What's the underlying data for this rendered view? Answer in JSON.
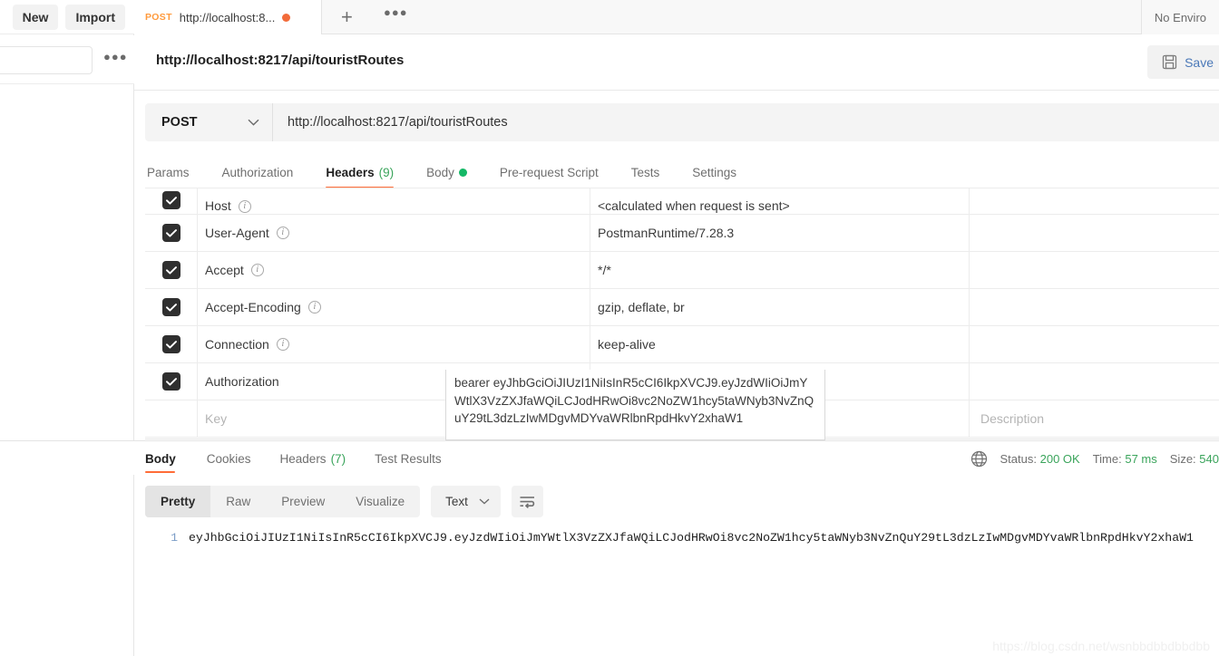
{
  "sidebar": {
    "new_label": "New",
    "import_label": "Import",
    "more_options": "···",
    "search_placeholder": ""
  },
  "tabbar": {
    "tabs": [
      {
        "method": "POST",
        "title": "http://localhost:8...",
        "unsaved": true
      }
    ],
    "new_tab_icon": "+",
    "tab_options_icon": "···",
    "environment_label": "No Enviro"
  },
  "request": {
    "name": "http://localhost:8217/api/touristRoutes",
    "save_label": "Save",
    "method": "POST",
    "url": "http://localhost:8217/api/touristRoutes",
    "tabs": [
      {
        "label": "Params",
        "active": false,
        "count": "",
        "dot": false
      },
      {
        "label": "Authorization",
        "active": false,
        "count": "",
        "dot": false
      },
      {
        "label": "Headers",
        "active": true,
        "count": "(9)",
        "dot": false
      },
      {
        "label": "Body",
        "active": false,
        "count": "",
        "dot": true
      },
      {
        "label": "Pre-request Script",
        "active": false,
        "count": "",
        "dot": false
      },
      {
        "label": "Tests",
        "active": false,
        "count": "",
        "dot": false
      },
      {
        "label": "Settings",
        "active": false,
        "count": "",
        "dot": false
      }
    ]
  },
  "headers_table": {
    "key_placeholder": "Key",
    "description_placeholder": "Description",
    "rows": [
      {
        "checked": true,
        "key": "Host",
        "info": true,
        "value": "<calculated when request is sent>",
        "description": ""
      },
      {
        "checked": true,
        "key": "User-Agent",
        "info": true,
        "value": "PostmanRuntime/7.28.3",
        "description": ""
      },
      {
        "checked": true,
        "key": "Accept",
        "info": true,
        "value": "*/*",
        "description": ""
      },
      {
        "checked": true,
        "key": "Accept-Encoding",
        "info": true,
        "value": "gzip, deflate, br",
        "description": ""
      },
      {
        "checked": true,
        "key": "Connection",
        "info": true,
        "value": "keep-alive",
        "description": ""
      },
      {
        "checked": true,
        "key": "Authorization",
        "info": false,
        "value": "",
        "description": ""
      }
    ],
    "authorization_value": "bearer eyJhbGciOiJIUzI1NiIsInR5cCI6IkpXVCJ9.eyJzdWIiOiJmYWtlX3VzZXJfaWQiLCJodHRwOi8vc2NoZW1hcy5taWNyb3NvZnQuY29tL3dzLzIwMDgvMDYvaWRlbnRpdHkvY2xhaW1"
  },
  "response": {
    "tabs": [
      {
        "label": "Body",
        "active": true,
        "count": ""
      },
      {
        "label": "Cookies",
        "active": false,
        "count": ""
      },
      {
        "label": "Headers",
        "active": false,
        "count": "(7)"
      },
      {
        "label": "Test Results",
        "active": false,
        "count": ""
      }
    ],
    "status_label": "Status:",
    "status_value": "200 OK",
    "time_label": "Time:",
    "time_value": "57 ms",
    "size_label": "Size:",
    "size_value": "540",
    "view_modes": [
      {
        "label": "Pretty",
        "active": true
      },
      {
        "label": "Raw",
        "active": false
      },
      {
        "label": "Preview",
        "active": false
      },
      {
        "label": "Visualize",
        "active": false
      }
    ],
    "format": "Text",
    "line_number": "1",
    "body_text": "eyJhbGciOiJIUzI1NiIsInR5cCI6IkpXVCJ9.eyJzdWIiOiJmYWtlX3VzZXJfaWQiLCJodHRwOi8vc2NoZW1hcy5taWNyb3NvZnQuY29tL3dzLzIwMDgvMDYvaWRlbnRpdHkvY2xhaW1"
  },
  "watermark": "https://blog.csdn.net/wsnbbdbbdbbdbb",
  "colors": {
    "accent_orange": "#ff6c37",
    "status_green": "#3aa45b",
    "method_post": "#ff9a3c",
    "link_blue": "#4a78b8",
    "unsaved_dot": "#f26b3a"
  }
}
